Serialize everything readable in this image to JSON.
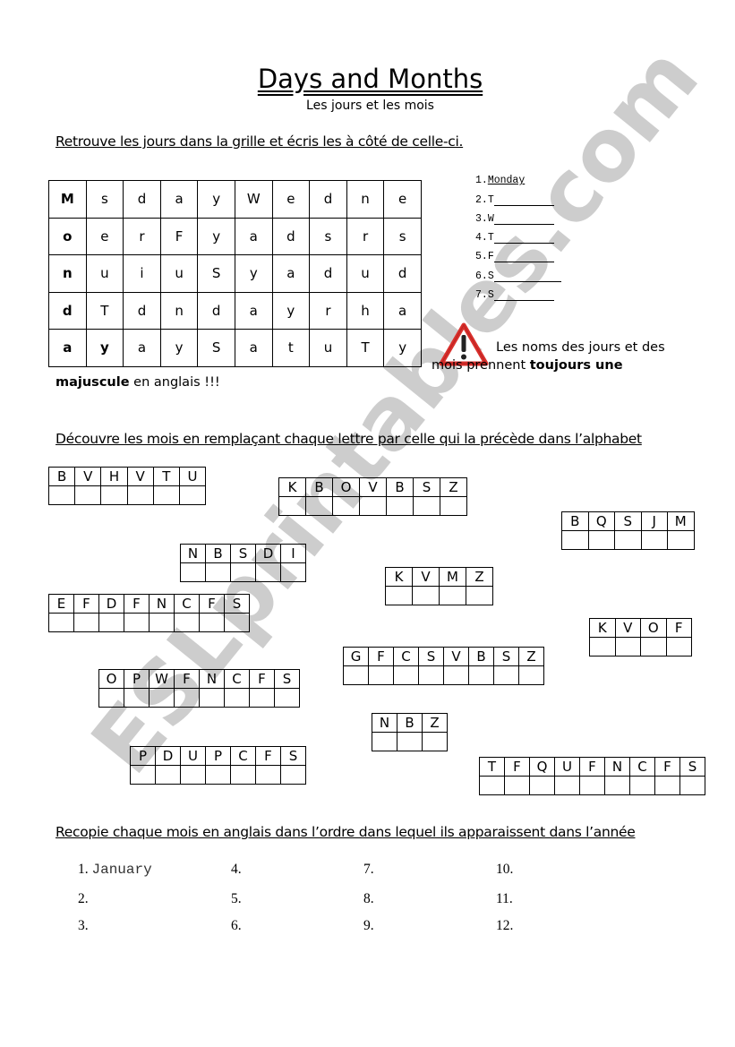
{
  "header": {
    "title": "Days and Months",
    "subtitle": "Les jours et les mois"
  },
  "section1": {
    "instruction": "Retrouve les jours dans la grille et écris les à côté de celle-ci.",
    "grid": [
      [
        "M",
        "s",
        "d",
        "a",
        "y",
        "W",
        "e",
        "d",
        "n",
        "e"
      ],
      [
        "o",
        "e",
        "r",
        "F",
        "y",
        "a",
        "d",
        "s",
        "r",
        "s"
      ],
      [
        "n",
        "u",
        "i",
        "u",
        "S",
        "y",
        "a",
        "d",
        "u",
        "d"
      ],
      [
        "d",
        "T",
        "d",
        "n",
        "d",
        "a",
        "y",
        "r",
        "h",
        "a"
      ],
      [
        "a",
        "y",
        "a",
        "y",
        "S",
        "a",
        "t",
        "u",
        "T",
        "y"
      ]
    ],
    "highlighted_word": "Monday",
    "day_list": [
      {
        "num": "1.",
        "prefix": "",
        "answer": "Monday"
      },
      {
        "num": "2.",
        "prefix": "T",
        "answer": ""
      },
      {
        "num": "3.",
        "prefix": "W",
        "answer": ""
      },
      {
        "num": "4.",
        "prefix": "T",
        "answer": ""
      },
      {
        "num": "5.",
        "prefix": "F",
        "answer": ""
      },
      {
        "num": "6.",
        "prefix": "S",
        "answer": ""
      },
      {
        "num": "7.",
        "prefix": "S",
        "answer": ""
      }
    ],
    "warning": {
      "icon": "warning-triangle-icon",
      "line1": "Les noms des jours et des",
      "line2_plain": "mois prennent ",
      "line2_bold": "toujours une",
      "line3_bold": "majuscule",
      "line3_plain": " en anglais !!!"
    }
  },
  "section2": {
    "instruction": "Découvre les mois en remplaçant chaque lettre par celle qui la précède dans l’alphabet",
    "coded_months": [
      {
        "letters": [
          "B",
          "V",
          "H",
          "V",
          "T",
          "U"
        ]
      },
      {
        "letters": [
          "K",
          "B",
          "O",
          "V",
          "B",
          "S",
          "Z"
        ]
      },
      {
        "letters": [
          "B",
          "Q",
          "S",
          "J",
          "M"
        ]
      },
      {
        "letters": [
          "N",
          "B",
          "S",
          "D",
          "I"
        ]
      },
      {
        "letters": [
          "K",
          "V",
          "M",
          "Z"
        ]
      },
      {
        "letters": [
          "E",
          "F",
          "D",
          "F",
          "N",
          "C",
          "F",
          "S"
        ]
      },
      {
        "letters": [
          "K",
          "V",
          "O",
          "F"
        ]
      },
      {
        "letters": [
          "G",
          "F",
          "C",
          "S",
          "V",
          "B",
          "S",
          "Z"
        ]
      },
      {
        "letters": [
          "O",
          "P",
          "W",
          "F",
          "N",
          "C",
          "F",
          "S"
        ]
      },
      {
        "letters": [
          "N",
          "B",
          "Z"
        ]
      },
      {
        "letters": [
          "P",
          "D",
          "U",
          "P",
          "C",
          "F",
          "S"
        ]
      },
      {
        "letters": [
          "T",
          "F",
          "Q",
          "U",
          "F",
          "N",
          "C",
          "F",
          "S"
        ]
      }
    ]
  },
  "section3": {
    "instruction": "Recopie chaque mois en anglais dans l’ordre dans lequel ils apparaissent dans l’année",
    "items": [
      {
        "num": "1.",
        "answer": "January"
      },
      {
        "num": "2.",
        "answer": ""
      },
      {
        "num": "3.",
        "answer": ""
      },
      {
        "num": "4.",
        "answer": ""
      },
      {
        "num": "5.",
        "answer": ""
      },
      {
        "num": "6.",
        "answer": ""
      },
      {
        "num": "7.",
        "answer": ""
      },
      {
        "num": "8.",
        "answer": ""
      },
      {
        "num": "9.",
        "answer": ""
      },
      {
        "num": "10.",
        "answer": ""
      },
      {
        "num": "11.",
        "answer": ""
      },
      {
        "num": "12.",
        "answer": ""
      }
    ]
  },
  "watermark": {
    "text": "ESLprintables.com",
    "color": "#c8c8c8"
  },
  "colors": {
    "warning_red": "#d9302c",
    "text": "#000000"
  }
}
